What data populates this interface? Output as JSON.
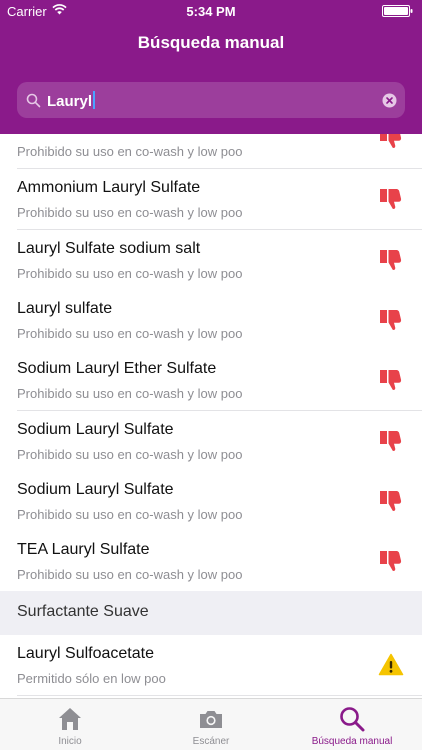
{
  "status_bar": {
    "carrier": "Carrier",
    "time": "5:34 PM"
  },
  "nav": {
    "title": "Búsqueda manual"
  },
  "search": {
    "query": "Lauryl"
  },
  "colors": {
    "brand": "#8a1a8a",
    "prohibited": "#e8424a",
    "warning": "#f5c400"
  },
  "rows": [
    {
      "title": "",
      "subtitle": "Prohibido su uso en co-wash y low poo",
      "icon": "thumbs-down-icon"
    },
    {
      "title": "Ammonium Lauryl Sulfate",
      "subtitle": "Prohibido su uso en co-wash y low poo",
      "icon": "thumbs-down-icon"
    },
    {
      "title": "Lauryl Sulfate sodium salt",
      "subtitle": "Prohibido su uso en co-wash y low poo",
      "icon": "thumbs-down-icon"
    },
    {
      "title": "Lauryl sulfate",
      "subtitle": "Prohibido su uso en co-wash y low poo",
      "icon": "thumbs-down-icon"
    },
    {
      "title": "Sodium Lauryl Ether Sulfate",
      "subtitle": "Prohibido su uso en co-wash y low poo",
      "icon": "thumbs-down-icon"
    },
    {
      "title": "Sodium Lauryl Sulfate",
      "subtitle": "Prohibido su uso en co-wash y low poo",
      "icon": "thumbs-down-icon"
    },
    {
      "title": "Sodium Lauryl Sulfate",
      "subtitle": "Prohibido su uso en co-wash y low poo",
      "icon": "thumbs-down-icon"
    },
    {
      "title": "TEA Lauryl Sulfate",
      "subtitle": "Prohibido su uso en co-wash y low poo",
      "icon": "thumbs-down-icon"
    }
  ],
  "section": {
    "label": "Surfactante Suave"
  },
  "rows_2": [
    {
      "title": "Lauryl Sulfoacetate",
      "subtitle": "Permitido sólo en low poo",
      "icon": "warning-icon"
    }
  ],
  "tabs": [
    {
      "label": "Inicio",
      "icon": "home-icon",
      "active": false
    },
    {
      "label": "Escáner",
      "icon": "camera-icon",
      "active": false
    },
    {
      "label": "Búsqueda manual",
      "icon": "search-icon",
      "active": true
    }
  ]
}
